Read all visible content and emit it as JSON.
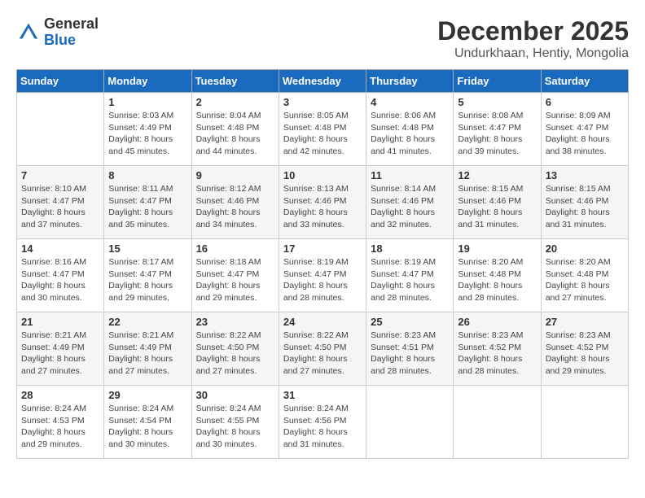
{
  "header": {
    "logo_line1": "General",
    "logo_line2": "Blue",
    "month": "December 2025",
    "location": "Undurkhaan, Hentiy, Mongolia"
  },
  "days_of_week": [
    "Sunday",
    "Monday",
    "Tuesday",
    "Wednesday",
    "Thursday",
    "Friday",
    "Saturday"
  ],
  "weeks": [
    [
      {
        "day": "",
        "info": ""
      },
      {
        "day": "1",
        "info": "Sunrise: 8:03 AM\nSunset: 4:49 PM\nDaylight: 8 hours\nand 45 minutes."
      },
      {
        "day": "2",
        "info": "Sunrise: 8:04 AM\nSunset: 4:48 PM\nDaylight: 8 hours\nand 44 minutes."
      },
      {
        "day": "3",
        "info": "Sunrise: 8:05 AM\nSunset: 4:48 PM\nDaylight: 8 hours\nand 42 minutes."
      },
      {
        "day": "4",
        "info": "Sunrise: 8:06 AM\nSunset: 4:48 PM\nDaylight: 8 hours\nand 41 minutes."
      },
      {
        "day": "5",
        "info": "Sunrise: 8:08 AM\nSunset: 4:47 PM\nDaylight: 8 hours\nand 39 minutes."
      },
      {
        "day": "6",
        "info": "Sunrise: 8:09 AM\nSunset: 4:47 PM\nDaylight: 8 hours\nand 38 minutes."
      }
    ],
    [
      {
        "day": "7",
        "info": "Sunrise: 8:10 AM\nSunset: 4:47 PM\nDaylight: 8 hours\nand 37 minutes."
      },
      {
        "day": "8",
        "info": "Sunrise: 8:11 AM\nSunset: 4:47 PM\nDaylight: 8 hours\nand 35 minutes."
      },
      {
        "day": "9",
        "info": "Sunrise: 8:12 AM\nSunset: 4:46 PM\nDaylight: 8 hours\nand 34 minutes."
      },
      {
        "day": "10",
        "info": "Sunrise: 8:13 AM\nSunset: 4:46 PM\nDaylight: 8 hours\nand 33 minutes."
      },
      {
        "day": "11",
        "info": "Sunrise: 8:14 AM\nSunset: 4:46 PM\nDaylight: 8 hours\nand 32 minutes."
      },
      {
        "day": "12",
        "info": "Sunrise: 8:15 AM\nSunset: 4:46 PM\nDaylight: 8 hours\nand 31 minutes."
      },
      {
        "day": "13",
        "info": "Sunrise: 8:15 AM\nSunset: 4:46 PM\nDaylight: 8 hours\nand 31 minutes."
      }
    ],
    [
      {
        "day": "14",
        "info": "Sunrise: 8:16 AM\nSunset: 4:47 PM\nDaylight: 8 hours\nand 30 minutes."
      },
      {
        "day": "15",
        "info": "Sunrise: 8:17 AM\nSunset: 4:47 PM\nDaylight: 8 hours\nand 29 minutes."
      },
      {
        "day": "16",
        "info": "Sunrise: 8:18 AM\nSunset: 4:47 PM\nDaylight: 8 hours\nand 29 minutes."
      },
      {
        "day": "17",
        "info": "Sunrise: 8:19 AM\nSunset: 4:47 PM\nDaylight: 8 hours\nand 28 minutes."
      },
      {
        "day": "18",
        "info": "Sunrise: 8:19 AM\nSunset: 4:47 PM\nDaylight: 8 hours\nand 28 minutes."
      },
      {
        "day": "19",
        "info": "Sunrise: 8:20 AM\nSunset: 4:48 PM\nDaylight: 8 hours\nand 28 minutes."
      },
      {
        "day": "20",
        "info": "Sunrise: 8:20 AM\nSunset: 4:48 PM\nDaylight: 8 hours\nand 27 minutes."
      }
    ],
    [
      {
        "day": "21",
        "info": "Sunrise: 8:21 AM\nSunset: 4:49 PM\nDaylight: 8 hours\nand 27 minutes."
      },
      {
        "day": "22",
        "info": "Sunrise: 8:21 AM\nSunset: 4:49 PM\nDaylight: 8 hours\nand 27 minutes."
      },
      {
        "day": "23",
        "info": "Sunrise: 8:22 AM\nSunset: 4:50 PM\nDaylight: 8 hours\nand 27 minutes."
      },
      {
        "day": "24",
        "info": "Sunrise: 8:22 AM\nSunset: 4:50 PM\nDaylight: 8 hours\nand 27 minutes."
      },
      {
        "day": "25",
        "info": "Sunrise: 8:23 AM\nSunset: 4:51 PM\nDaylight: 8 hours\nand 28 minutes."
      },
      {
        "day": "26",
        "info": "Sunrise: 8:23 AM\nSunset: 4:52 PM\nDaylight: 8 hours\nand 28 minutes."
      },
      {
        "day": "27",
        "info": "Sunrise: 8:23 AM\nSunset: 4:52 PM\nDaylight: 8 hours\nand 29 minutes."
      }
    ],
    [
      {
        "day": "28",
        "info": "Sunrise: 8:24 AM\nSunset: 4:53 PM\nDaylight: 8 hours\nand 29 minutes."
      },
      {
        "day": "29",
        "info": "Sunrise: 8:24 AM\nSunset: 4:54 PM\nDaylight: 8 hours\nand 30 minutes."
      },
      {
        "day": "30",
        "info": "Sunrise: 8:24 AM\nSunset: 4:55 PM\nDaylight: 8 hours\nand 30 minutes."
      },
      {
        "day": "31",
        "info": "Sunrise: 8:24 AM\nSunset: 4:56 PM\nDaylight: 8 hours\nand 31 minutes."
      },
      {
        "day": "",
        "info": ""
      },
      {
        "day": "",
        "info": ""
      },
      {
        "day": "",
        "info": ""
      }
    ]
  ]
}
